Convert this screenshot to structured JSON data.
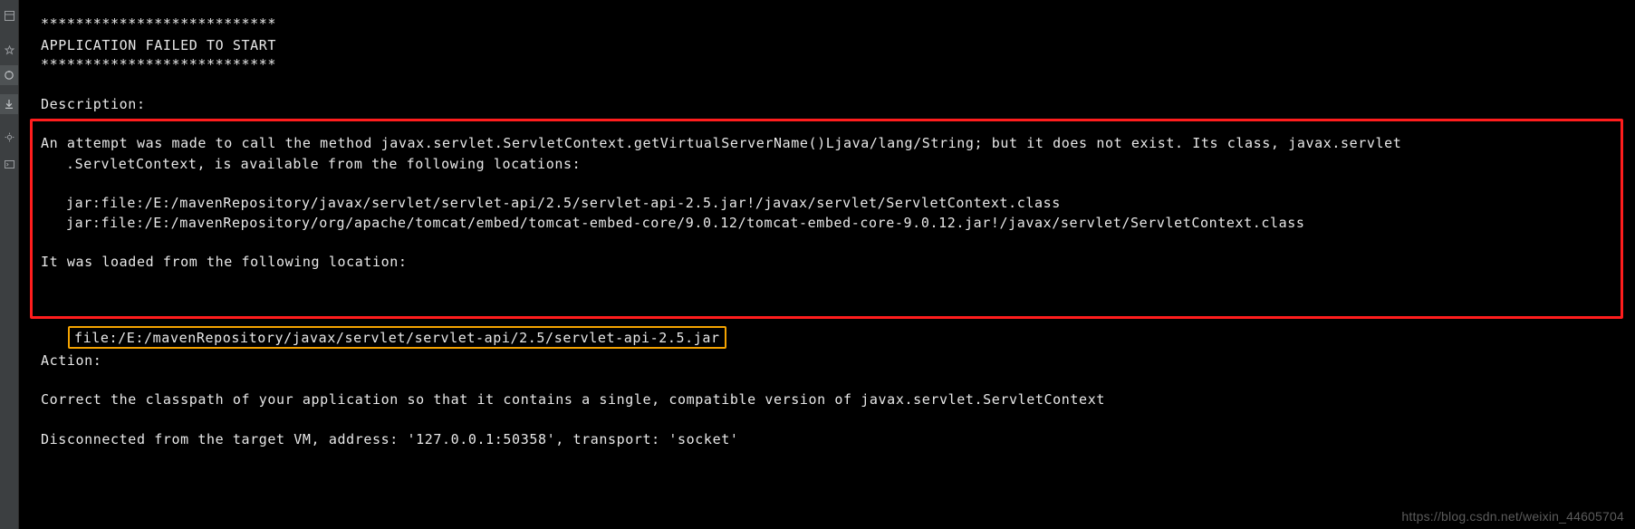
{
  "gutter": {
    "items": [
      {
        "name": "structure-icon",
        "glyph": "▤"
      },
      {
        "name": "favorites-icon",
        "glyph": "★"
      },
      {
        "name": "debugger-icon",
        "glyph": "◎",
        "active": true
      },
      {
        "name": "download-icon",
        "glyph": "⤓",
        "active": true
      },
      {
        "name": "build-icon",
        "glyph": "⚙"
      },
      {
        "name": "terminal-icon",
        "glyph": "▮"
      }
    ]
  },
  "console": {
    "banner_top": "***************************",
    "banner_title": "APPLICATION FAILED TO START",
    "banner_bottom": "***************************",
    "description_label": "Description:",
    "description_line1": "An attempt was made to call the method javax.servlet.ServletContext.getVirtualServerName()Ljava/lang/String; but it does not exist. Its class, javax.servlet",
    "description_line2": ".ServletContext, is available from the following locations:",
    "locations": [
      "jar:file:/E:/mavenRepository/javax/servlet/servlet-api/2.5/servlet-api-2.5.jar!/javax/servlet/ServletContext.class",
      "jar:file:/E:/mavenRepository/org/apache/tomcat/embed/tomcat-embed-core/9.0.12/tomcat-embed-core-9.0.12.jar!/javax/servlet/ServletContext.class"
    ],
    "loaded_from_label": "It was loaded from the following location:",
    "loaded_from_path": "file:/E:/mavenRepository/javax/servlet/servlet-api/2.5/servlet-api-2.5.jar",
    "action_label": "Action:",
    "action_text": "Correct the classpath of your application so that it contains a single, compatible version of javax.servlet.ServletContext",
    "disconnect_text": "Disconnected from the target VM, address: '127.0.0.1:50358', transport: 'socket'"
  },
  "watermark": "https://blog.csdn.net/weixin_44605704",
  "colors": {
    "background": "#000000",
    "text": "#e8e8e8",
    "error_box_border": "#ff1d1d",
    "highlight_box_border": "#f4a300",
    "gutter_background": "#3c3f41",
    "watermark": "#5b5b5b"
  }
}
